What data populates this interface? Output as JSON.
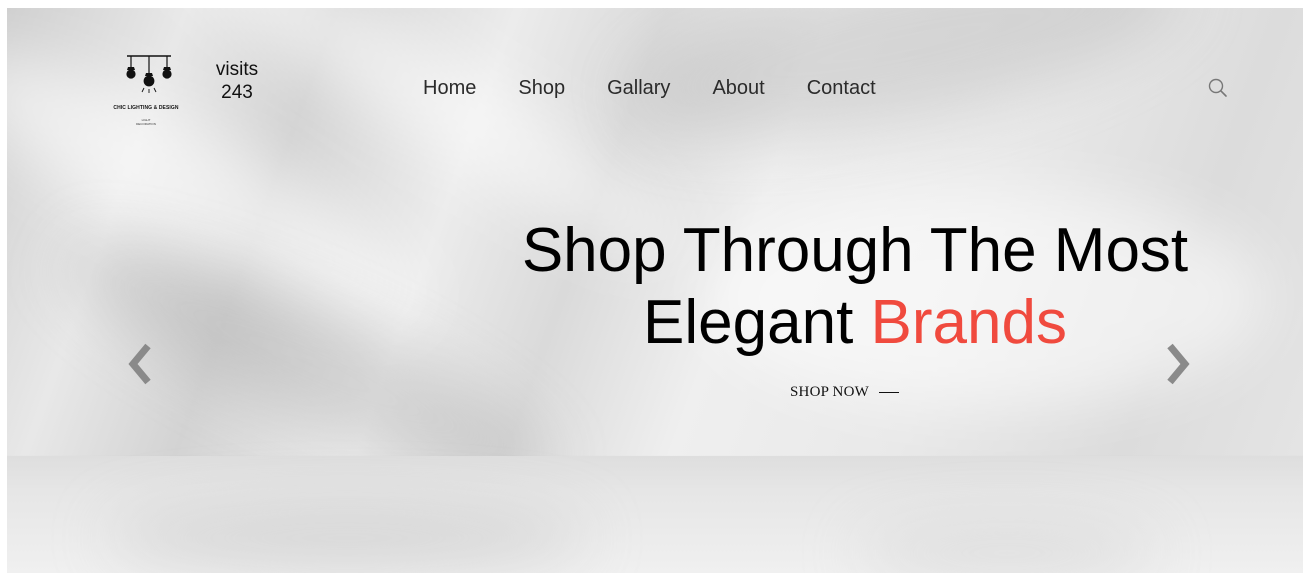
{
  "brand": {
    "logo_icon": "pendant-lights-icon",
    "name": "CHIC LIGHTING & DESIGN",
    "tagline_line1": "LIGHT",
    "tagline_line2": "DECORATION"
  },
  "visits": {
    "label": "visits",
    "count": "243"
  },
  "nav": {
    "items": [
      {
        "label": "Home"
      },
      {
        "label": "Shop"
      },
      {
        "label": "Gallary"
      },
      {
        "label": "About"
      },
      {
        "label": "Contact"
      }
    ],
    "search_icon": "search-icon"
  },
  "hero": {
    "headline_line1": "Shop Through The Most",
    "headline_line2_start": "Elegant",
    "headline_line2_accent": "Brands",
    "cta_label": "SHOP NOW",
    "prev_icon": "chevron-left-icon",
    "next_icon": "chevron-right-icon"
  },
  "colors": {
    "accent": "#f04a3e",
    "text": "#000000",
    "arrow": "#8a8a8a"
  }
}
